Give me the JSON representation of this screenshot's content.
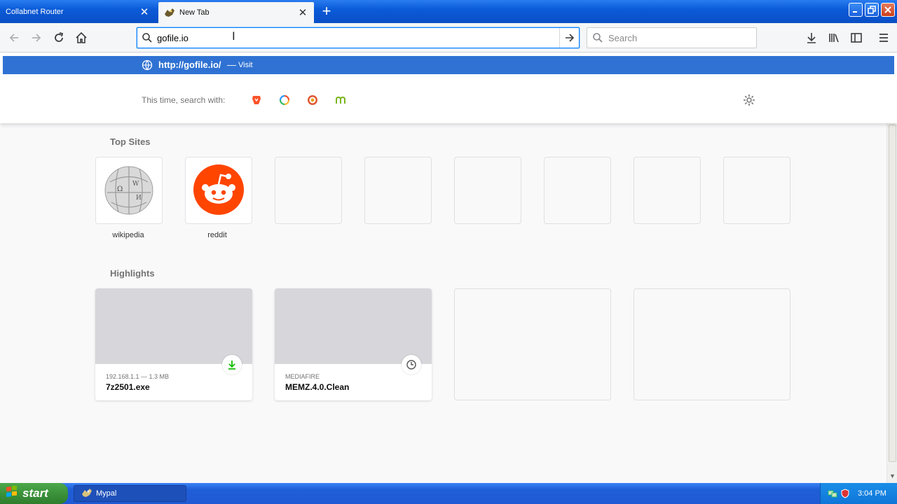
{
  "tabs": [
    {
      "title": "Collabnet Router",
      "active": false
    },
    {
      "title": "New Tab",
      "active": true
    }
  ],
  "urlbar": {
    "value": "gofile.io"
  },
  "searchbar": {
    "placeholder": "Search"
  },
  "autocomplete": {
    "url": "http://gofile.io/",
    "separator": "—",
    "action": "Visit"
  },
  "oneoff": {
    "label": "This time, search with:",
    "engines": [
      "brave-icon",
      "qwant-icon",
      "duckduckgo-icon",
      "mojeek-icon"
    ]
  },
  "topsites": {
    "title": "Top Sites",
    "items": [
      {
        "label": "wikipedia",
        "icon": "wikipedia-icon"
      },
      {
        "label": "reddit",
        "icon": "reddit-icon"
      }
    ]
  },
  "highlights": {
    "title": "Highlights",
    "cards": [
      {
        "source": "192.168.1.1 — 1.3 MB",
        "title": "7z2501.exe",
        "badge": "download-icon"
      },
      {
        "source": "MEDIAFIRE",
        "title": "MEMZ.4.0.Clean",
        "badge": "clock-icon"
      }
    ]
  },
  "taskbar": {
    "start_label": "start",
    "task_label": "Mypal",
    "clock": "3:04 PM"
  },
  "colors": {
    "accent": "#0a84ff",
    "autocomplete_highlight": "#2f72d3",
    "xp_taskbar": "#245edb",
    "start_green": "#3b923a"
  }
}
